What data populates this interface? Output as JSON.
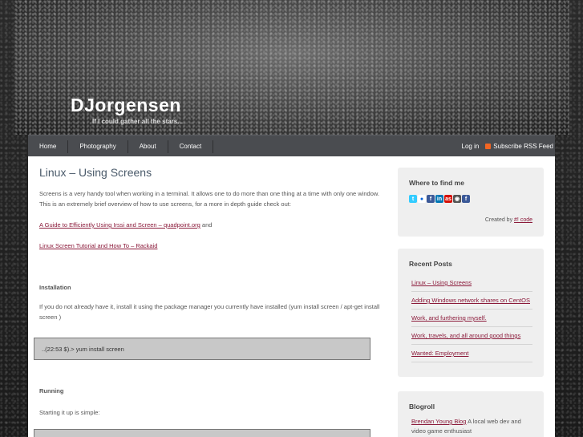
{
  "site": {
    "title": "DJorgensen",
    "tagline": "If I could gather all the stars..."
  },
  "nav": {
    "items": [
      "Home",
      "Photography",
      "About",
      "Contact"
    ],
    "login": "Log in",
    "rss": "Subscribe RSS Feed"
  },
  "post": {
    "title": "Linux – Using Screens",
    "intro": "Screens is a very handy tool when working in a terminal. It allows one to do more than one thing at a time with only one window. This is an extremely brief overview of how to use screens, for a more in depth guide check out:",
    "link1": "A Guide to Efficiently Using Irssi and Screen – quadpoint.org",
    "link1_suffix": " and",
    "link2": "Linux Screen Tutorial and How To – Rackaid",
    "installation_heading": "Installation",
    "installation_text": "If you do not already have it, install it using the package manager you currently have installed (yum install screen / apt-get install screen )",
    "install_cmd": "..(22:53 $).> yum install screen",
    "running_heading": "Running",
    "running_text": "Starting it up is simple:"
  },
  "sidebar": {
    "find_me": {
      "title": "Where to find me",
      "icons": [
        "twitter-icon",
        "flickr-icon",
        "facebook-icon",
        "linkedin-icon",
        "lastfm-icon",
        "github-icon",
        "facebook-icon"
      ],
      "created_by": "Created by",
      "created_link": "#! code"
    },
    "recent": {
      "title": "Recent Posts",
      "items": [
        "Linux – Using Screens",
        "Adding Windows network shares on CentOS",
        "Work, and furthering myself.",
        "Work, travels, and all around good things",
        "Wanted: Employment"
      ]
    },
    "blogroll": {
      "title": "Blogroll",
      "link": "Brendan Young Blog",
      "text": " A local web dev and video game enthusiast"
    }
  },
  "colors": {
    "nav_bg": "#4a4c50",
    "link": "#8b1a3a",
    "sidebar_bg": "#efefef",
    "rss": "#f26522"
  }
}
